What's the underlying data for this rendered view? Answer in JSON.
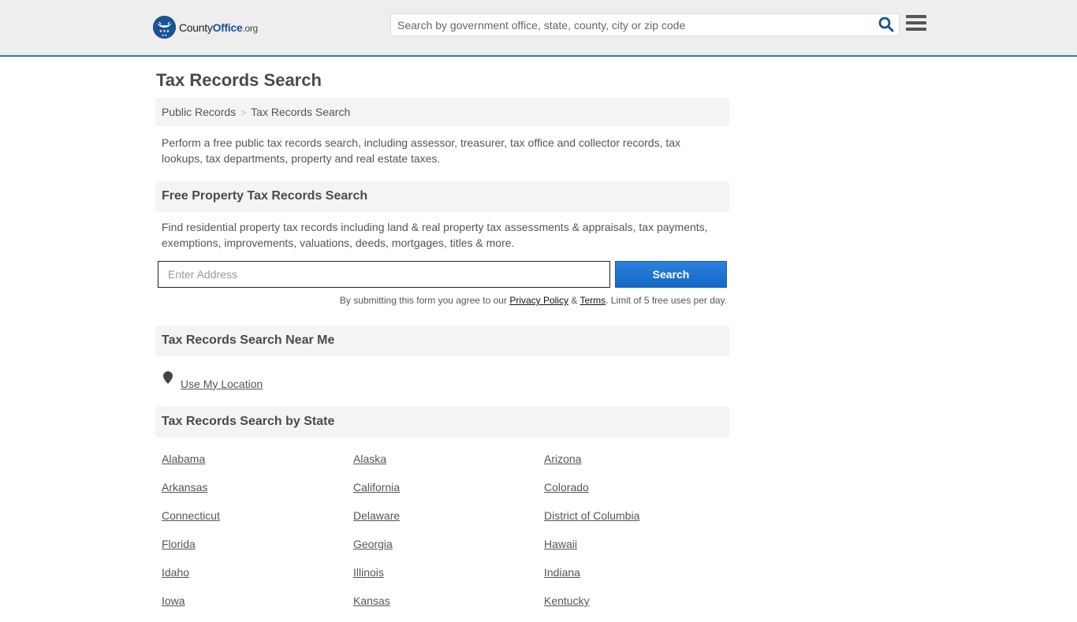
{
  "header": {
    "logo": {
      "brand_part1": "County",
      "brand_part2": "Office",
      "brand_tld": ".org"
    },
    "search": {
      "placeholder": "Search by government office, state, county, city or zip code",
      "icon": "search-icon"
    },
    "menu_icon": "hamburger-menu-icon",
    "colors": {
      "brand": "#1b5295",
      "accent_border": "#3378b0",
      "bar_bg": "#eeeeee"
    }
  },
  "page": {
    "title": "Tax Records Search",
    "breadcrumb": [
      {
        "label": "Public Records"
      },
      {
        "label": "Tax Records Search"
      }
    ],
    "breadcrumb_separator": ">",
    "intro": "Perform a free public tax records search, including assessor, treasurer, tax office and collector records, tax lookups, tax departments, property and real estate taxes."
  },
  "property_search": {
    "heading": "Free Property Tax Records Search",
    "description": "Find residential property tax records including land & real property tax assessments & appraisals, tax payments, exemptions, improvements, valuations, deeds, mortgages, titles & more.",
    "address_placeholder": "Enter Address",
    "address_value": "",
    "button_label": "Search",
    "button_color": "#1a6fcf",
    "disclaimer_prefix": "By submitting this form you agree to our ",
    "privacy_link": "Privacy Policy",
    "disclaimer_and": " & ",
    "terms_link": "Terms",
    "disclaimer_suffix": ". Limit of 5 free uses per day."
  },
  "near_me": {
    "heading": "Tax Records Search Near Me",
    "location_icon": "map-pin-icon",
    "link_label": "Use My Location"
  },
  "by_state": {
    "heading": "Tax Records Search by State",
    "states": [
      "Alabama",
      "Alaska",
      "Arizona",
      "Arkansas",
      "California",
      "Colorado",
      "Connecticut",
      "Delaware",
      "District of Columbia",
      "Florida",
      "Georgia",
      "Hawaii",
      "Idaho",
      "Illinois",
      "Indiana",
      "Iowa",
      "Kansas",
      "Kentucky"
    ]
  }
}
